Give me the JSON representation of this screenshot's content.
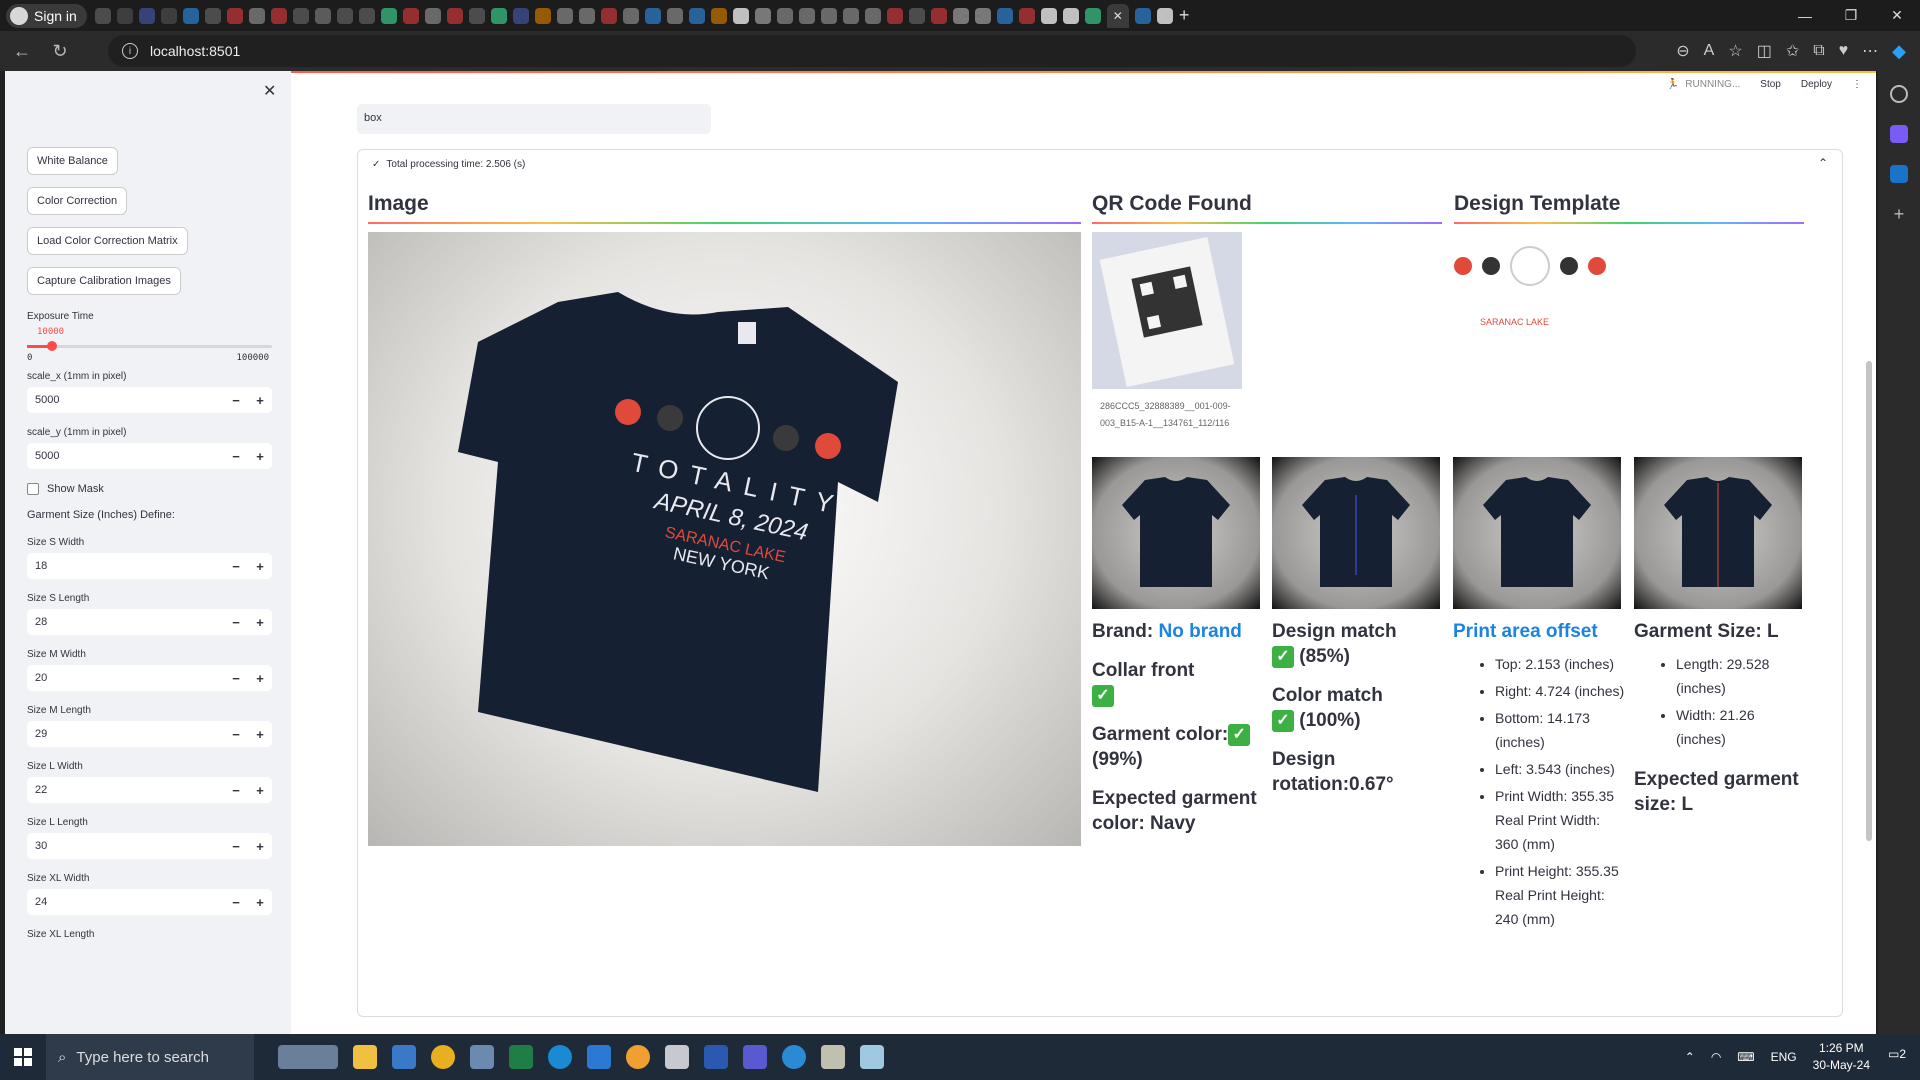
{
  "browser": {
    "signin_label": "Sign in",
    "url": "localhost:8501"
  },
  "sidebar": {
    "buttons": [
      "White Balance",
      "Color Correction",
      "Load Color Correction Matrix",
      "Capture Calibration Images"
    ],
    "exposure": {
      "label": "Exposure Time",
      "value": "10000",
      "min": "0",
      "max": "100000",
      "fraction": 0.1
    },
    "scale_x": {
      "label": "scale_x (1mm in pixel)",
      "value": "5000"
    },
    "scale_y": {
      "label": "scale_y (1mm in pixel)",
      "value": "5000"
    },
    "show_mask": "Show Mask",
    "garment_heading": "Garment Size (Inches) Define:",
    "sizes": [
      {
        "label": "Size S Width",
        "value": "18"
      },
      {
        "label": "Size S Length",
        "value": "28"
      },
      {
        "label": "Size M Width",
        "value": "20"
      },
      {
        "label": "Size M Length",
        "value": "29"
      },
      {
        "label": "Size L Width",
        "value": "22"
      },
      {
        "label": "Size L Length",
        "value": "30"
      },
      {
        "label": "Size XL Width",
        "value": "24"
      }
    ],
    "last_label": "Size XL Length"
  },
  "toolbar": {
    "running": "RUNNING...",
    "stop": "Stop",
    "deploy": "Deploy"
  },
  "main": {
    "search_value": "box",
    "expander_title": "Total processing time: 2.506 (s)",
    "headers": {
      "image": "Image",
      "qr": "QR Code Found",
      "design": "Design Template"
    },
    "qr_caption": "286CCC5_32888389__001-009-003_B15-A-1__134761_112/116",
    "design_text": "SARANAC LAKE",
    "shirt_text": {
      "line1": "TOTALITY",
      "line2": "APRIL 8, 2024",
      "line3": "SARANAC LAKE",
      "line4": "NEW YORK"
    },
    "col1": {
      "brand_label": "Brand:",
      "brand_value": "No brand",
      "collar": "Collar front",
      "garment_color": "Garment color:",
      "garment_color_pct": "(99%)",
      "expected_color": "Expected garment color: Navy"
    },
    "col2": {
      "design_match": "Design match",
      "design_match_pct": "(85%)",
      "color_match": "Color match",
      "color_match_pct": "(100%)",
      "rotation": "Design rotation:0.67°"
    },
    "col3": {
      "title": "Print area offset",
      "items": [
        "Top: 2.153 (inches)",
        "Right: 4.724 (inches)",
        "Bottom: 14.173 (inches)",
        "Left: 3.543 (inches)",
        "Print Width: 355.35 Real Print Width: 360 (mm)",
        "Print Height: 355.35 Real Print Height: 240 (mm)"
      ]
    },
    "col4": {
      "title": "Garment Size: L",
      "items": [
        "Length: 29.528 (inches)",
        "Width: 21.26 (inches)"
      ],
      "expected": "Expected garment size: L"
    }
  },
  "taskbar": {
    "search_placeholder": "Type here to search",
    "lang": "ENG",
    "time": "1:26 PM",
    "date": "30-May-24",
    "notif_count": "2"
  }
}
